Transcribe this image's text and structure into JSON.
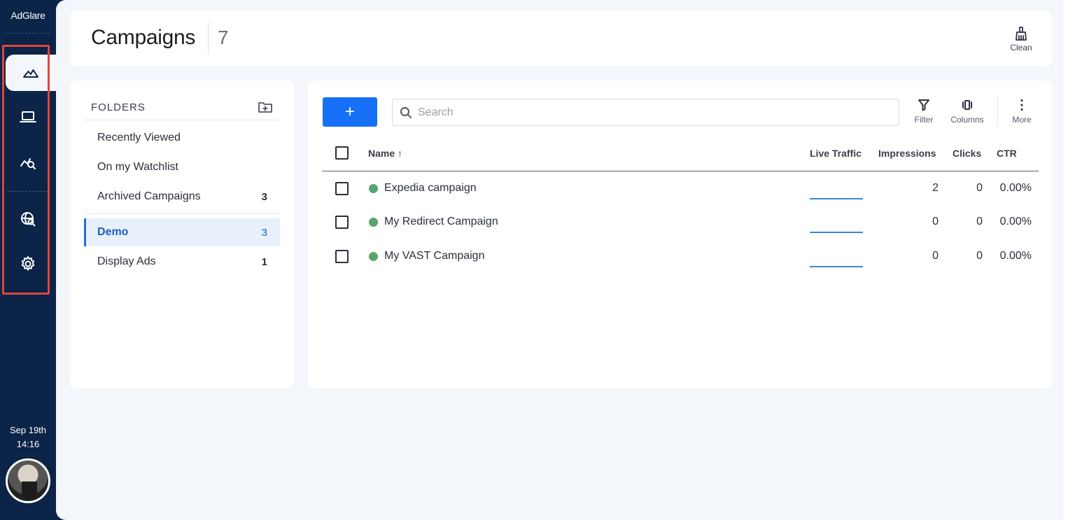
{
  "app": {
    "logo": "AdGlare"
  },
  "sidebar": {
    "items": [
      {
        "icon": "campaigns-mountain-icon",
        "active": true
      },
      {
        "icon": "laptop-icon",
        "active": false
      },
      {
        "icon": "analytics-search-icon",
        "active": false
      },
      {
        "icon": "globe-search-icon",
        "active": false
      },
      {
        "icon": "gear-icon",
        "active": false
      }
    ],
    "date": "Sep 19th",
    "time": "14:16"
  },
  "header": {
    "title": "Campaigns",
    "count": "7",
    "clean_label": "Clean"
  },
  "folders": {
    "heading": "FOLDERS",
    "items": [
      {
        "label": "Recently Viewed",
        "count": ""
      },
      {
        "label": "On my Watchlist",
        "count": ""
      },
      {
        "label": "Archived Campaigns",
        "count": "3"
      },
      {
        "label": "Demo",
        "count": "3",
        "selected": true
      },
      {
        "label": "Display Ads",
        "count": "1"
      }
    ]
  },
  "toolbar": {
    "add_label": "+",
    "search_placeholder": "Search",
    "search_value": "",
    "filter_label": "Filter",
    "columns_label": "Columns",
    "more_label": "More"
  },
  "table": {
    "columns": {
      "name": "Name ↑",
      "live": "Live Traffic",
      "impressions": "Impressions",
      "clicks": "Clicks",
      "ctr": "CTR"
    },
    "rows": [
      {
        "name": "Expedia campaign",
        "impressions": "2",
        "clicks": "0",
        "ctr": "0.00%",
        "status_color": "#5aa56f"
      },
      {
        "name": "My Redirect Campaign",
        "impressions": "0",
        "clicks": "0",
        "ctr": "0.00%",
        "status_color": "#5aa56f"
      },
      {
        "name": "My VAST Campaign",
        "impressions": "0",
        "clicks": "0",
        "ctr": "0.00%",
        "status_color": "#5aa56f"
      }
    ]
  },
  "colors": {
    "sidebar": "#0b2447",
    "accent": "#1671f7",
    "status": "#5aa56f",
    "highlight": "#e0463a"
  }
}
